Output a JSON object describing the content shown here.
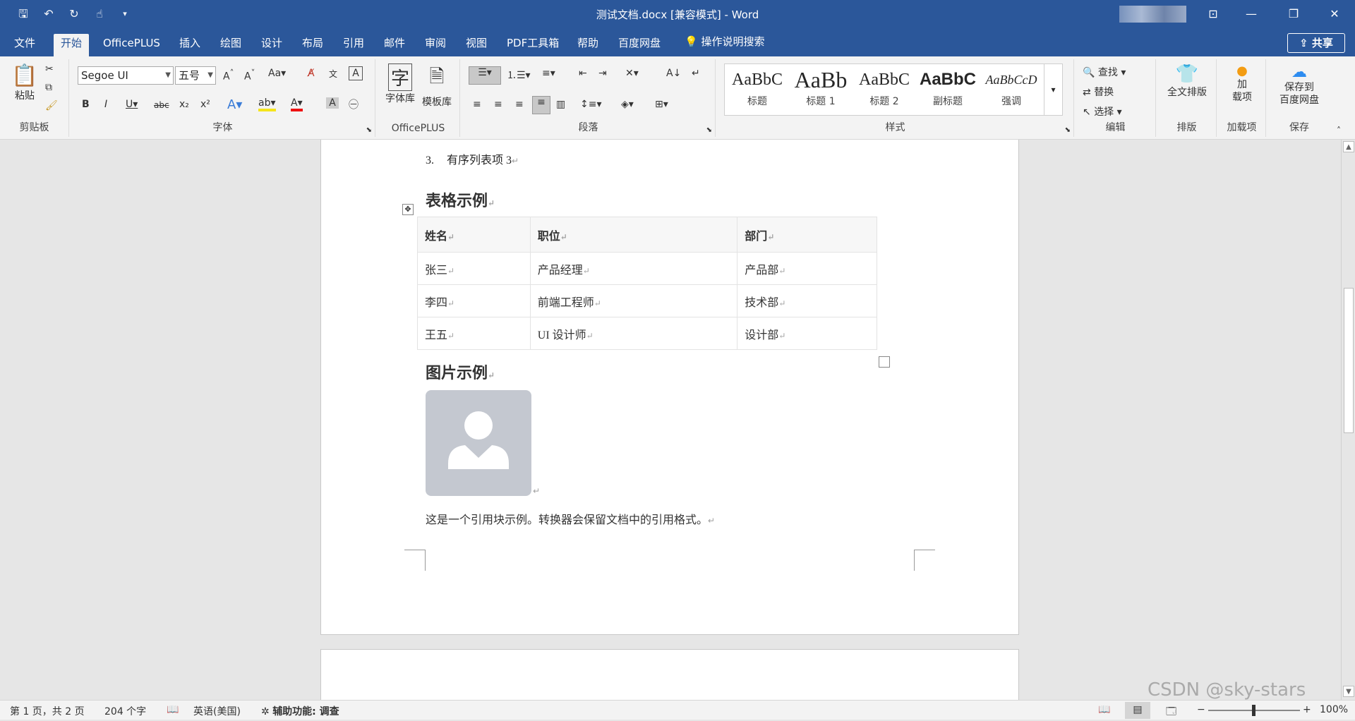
{
  "window": {
    "title": "测试文档.docx [兼容模式] - Word",
    "blurred_user": "",
    "share_label": "共享"
  },
  "tabs": [
    "文件",
    "开始",
    "OfficePLUS",
    "插入",
    "绘图",
    "设计",
    "布局",
    "引用",
    "邮件",
    "审阅",
    "视图",
    "PDF工具箱",
    "帮助",
    "百度网盘"
  ],
  "active_tab": "开始",
  "tell_me": "操作说明搜索",
  "ribbon": {
    "clipboard": {
      "paste": "粘贴",
      "label": "剪贴板"
    },
    "font": {
      "name": "Segoe UI",
      "size": "五号",
      "label": "字体"
    },
    "officeplus": {
      "fontlib": "字体库",
      "templatelib": "模板库",
      "label": "OfficePLUS"
    },
    "paragraph": {
      "label": "段落"
    },
    "styles": {
      "label": "样式",
      "items": [
        {
          "preview": "AaBbC",
          "name": "标题"
        },
        {
          "preview": "AaBb",
          "name": "标题 1"
        },
        {
          "preview": "AaBbC",
          "name": "标题 2"
        },
        {
          "preview": "AaBbC",
          "name": "副标题"
        },
        {
          "preview": "AaBbCcD",
          "name": "强调"
        }
      ]
    },
    "editing": {
      "find": "查找",
      "replace": "替换",
      "select": "选择",
      "label": "编辑"
    },
    "layout": {
      "fulltext": "全文排版",
      "label": "排版"
    },
    "addins": {
      "button": "加\n载项",
      "label": "加载项"
    },
    "save": {
      "button": "保存到\n百度网盘",
      "label": "保存"
    }
  },
  "document": {
    "list_item": {
      "num": "3.",
      "text": "有序列表项 3"
    },
    "table_heading": "表格示例",
    "table": {
      "headers": [
        "姓名",
        "职位",
        "部门"
      ],
      "rows": [
        [
          "张三",
          "产品经理",
          "产品部"
        ],
        [
          "李四",
          "前端工程师",
          "技术部"
        ],
        [
          "王五",
          "UI 设计师",
          "设计部"
        ]
      ]
    },
    "image_heading": "图片示例",
    "quote": "这是一个引用块示例。转换器会保留文档中的引用格式。"
  },
  "status": {
    "page": "第 1 页，共 2 页",
    "words": "204 个字",
    "language": "英语(美国)",
    "accessibility": "辅助功能: 调查",
    "zoom": "100%",
    "watermark": "CSDN @sky-stars"
  },
  "colors": {
    "brand": "#2b579a",
    "ribbon_bg": "#f3f3f3",
    "workspace": "#e6e6e6"
  }
}
